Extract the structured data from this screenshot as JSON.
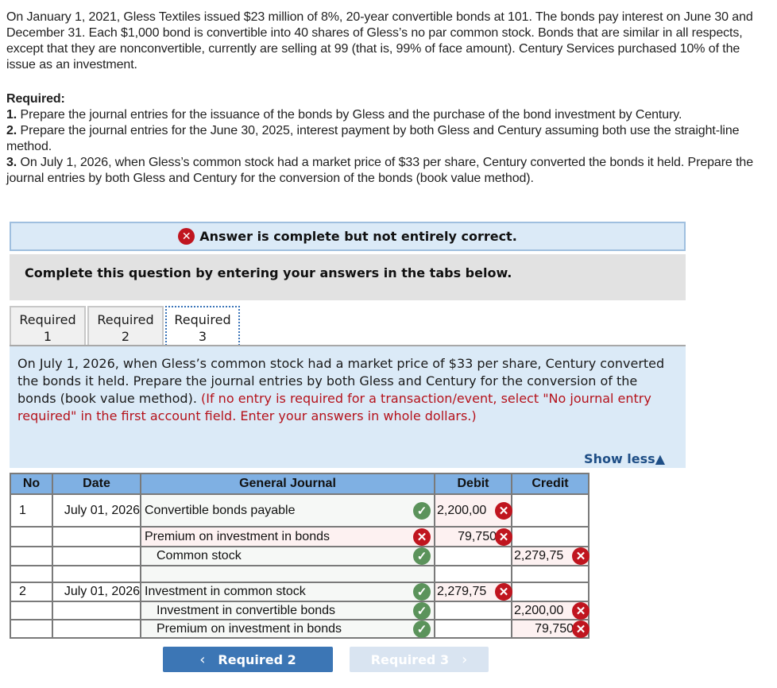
{
  "problem": {
    "text": "On January 1, 2021, Gless Textiles issued $23 million of 8%, 20-year convertible bonds at 101. The bonds pay interest on June 30 and December 31. Each $1,000 bond is convertible into 40 shares of Gless’s no par common stock. Bonds that are similar in all respects, except that they are nonconvertible, currently are selling at 99 (that is, 99% of face amount). Century Services purchased 10% of the issue as an investment."
  },
  "required": {
    "title": "Required:",
    "items": [
      {
        "num": "1.",
        "text": " Prepare the journal entries for the issuance of the bonds by Gless and the purchase of the bond investment by Century."
      },
      {
        "num": "2.",
        "text": " Prepare the journal entries for the June 30, 2025, interest payment by both Gless and Century assuming both use the straight-line method."
      },
      {
        "num": "3.",
        "text": " On July 1, 2026, when Gless’s common stock had a market price of $33 per share, Century converted the bonds it held. Prepare the journal entries by both Gless and Century for the conversion of the bonds (book value method)."
      }
    ]
  },
  "status": {
    "icon": "✕",
    "message": "Answer is complete but not entirely correct."
  },
  "instructions": "Complete this question by entering your answers in the tabs below.",
  "tabs": [
    {
      "line1": "Required",
      "line2": "1",
      "active": false
    },
    {
      "line1": "Required",
      "line2": "2",
      "active": false
    },
    {
      "line1": "Required",
      "line2": "3",
      "active": true
    }
  ],
  "question": {
    "text": "On July 1, 2026, when Gless’s common stock had a market price of $33 per share, Century converted the bonds it held. Prepare the journal entries by both Gless and Century for the conversion of the bonds (book value method).",
    "hint": "(If no entry is required for a transaction/event, select \"No journal entry required\" in the first account field. Enter your answers in whole dollars.)",
    "show_less": "Show less▲"
  },
  "journal": {
    "headers": {
      "no": "No",
      "date": "Date",
      "account": "General Journal",
      "debit": "Debit",
      "credit": "Credit"
    },
    "rows": [
      {
        "no": "1",
        "date": "July 01, 2026",
        "account": "Convertible bonds payable",
        "account_status": "correct",
        "debit": "2,200,00",
        "debit_status": "incorrect",
        "credit": "",
        "credit_status": ""
      },
      {
        "no": "",
        "date": "",
        "account": "Premium on investment in bonds",
        "account_status": "incorrect",
        "debit": "79,750",
        "debit_status": "incorrect",
        "credit": "",
        "credit_status": ""
      },
      {
        "no": "",
        "date": "",
        "account": "Common stock",
        "account_status": "correct",
        "debit": "",
        "debit_status": "",
        "credit": "2,279,75",
        "credit_status": "incorrect"
      },
      {
        "no": "",
        "date": "",
        "account": "",
        "account_status": "",
        "debit": "",
        "debit_status": "",
        "credit": "",
        "credit_status": ""
      },
      {
        "no": "2",
        "date": "July 01, 2026",
        "account": "Investment in common stock",
        "account_status": "correct",
        "debit": "2,279,75",
        "debit_status": "incorrect",
        "credit": "",
        "credit_status": ""
      },
      {
        "no": "",
        "date": "",
        "account": "Investment in convertible bonds",
        "account_status": "correct",
        "debit": "",
        "debit_status": "",
        "credit": "2,200,00",
        "credit_status": "incorrect"
      },
      {
        "no": "",
        "date": "",
        "account": "Premium on investment in bonds",
        "account_status": "correct",
        "debit": "",
        "debit_status": "",
        "credit": "79,750",
        "credit_status": "incorrect"
      }
    ]
  },
  "nav": {
    "prev_label": "Required 2",
    "next_label": "Required 3",
    "prev_icon": "‹",
    "next_icon": "›"
  },
  "colors": {
    "correct": "#5b935b",
    "incorrect": "#c0151f",
    "header_bg": "#7fb0e3",
    "nav_primary": "#3c76b5"
  }
}
